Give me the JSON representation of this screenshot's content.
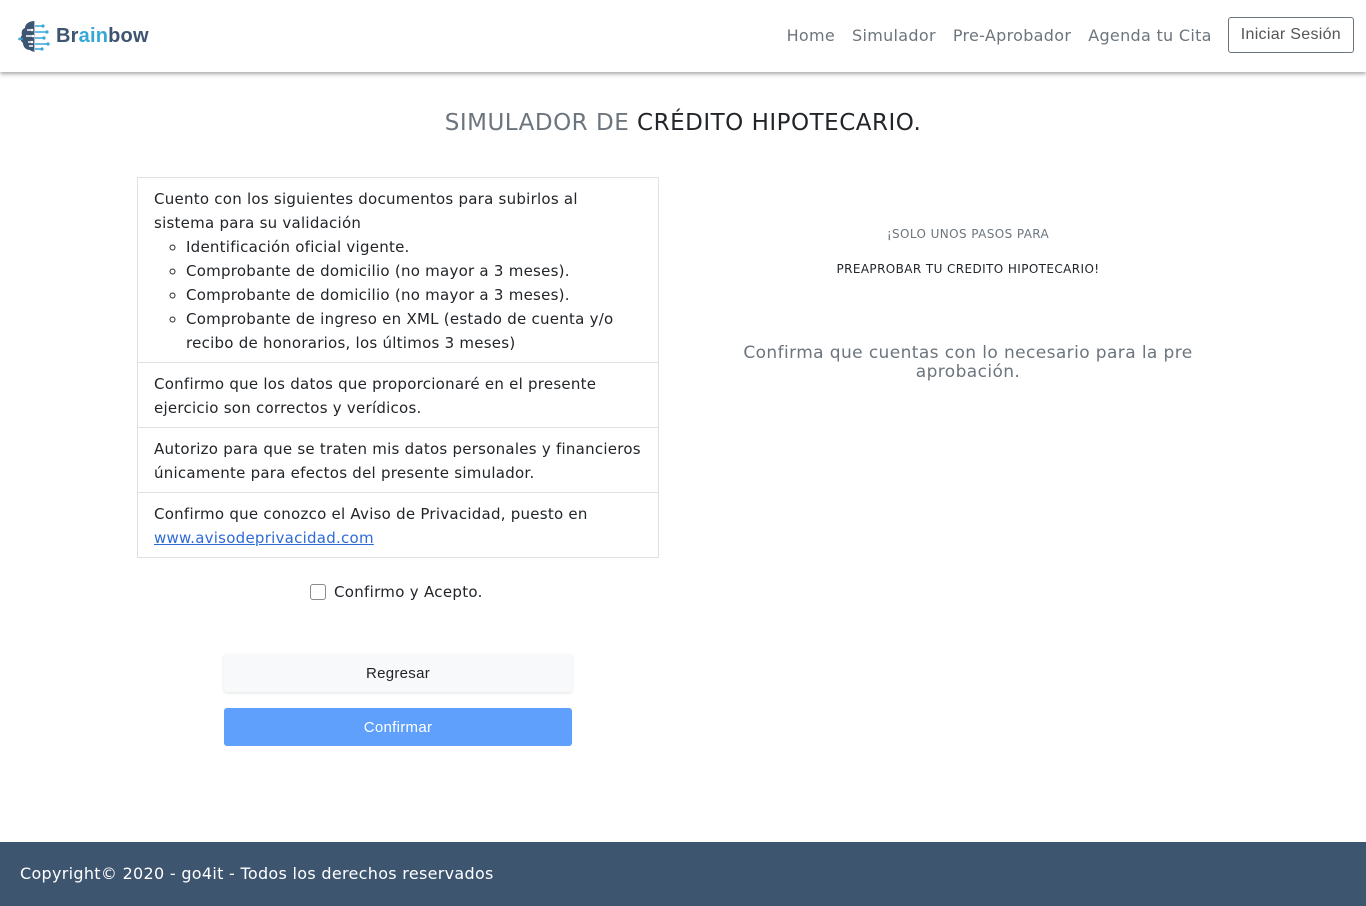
{
  "header": {
    "logo": {
      "part1": "Br",
      "part2": "ain",
      "part3": "bow",
      "icon": "brain-circuit-icon"
    },
    "nav": [
      "Home",
      "Simulador",
      "Pre-Aprobador",
      "Agenda tu Cita"
    ],
    "login_label": "Iniciar Sesión"
  },
  "title": {
    "muted": "SIMULADOR DE",
    "strong": "CRÉDITO HIPOTECARIO."
  },
  "requirements": {
    "intro": "Cuento con los siguientes documentos para subirlos al sistema para su validación",
    "docs": [
      "Identificación oficial vigente.",
      "Comprobante de domicilio (no mayor a 3 meses).",
      "Comprobante de domicilio (no mayor a 3 meses).",
      "Comprobante de ingreso en XML (estado de cuenta y/o recibo de honorarios, los últimos 3 meses)"
    ],
    "item2": "Confirmo que los datos que proporcionaré en el presente ejercicio son correctos y verídicos.",
    "item3": "Autorizo para que se traten mis datos personales y financieros únicamente para efectos del presente simulador.",
    "item4_text": "Confirmo que conozco el Aviso de Privacidad, puesto en",
    "item4_link": "www.avisodeprivacidad.com"
  },
  "confirm_label": "Confirmo y Acepto.",
  "buttons": {
    "back": "Regresar",
    "confirm": "Confirmar"
  },
  "right": {
    "line1": "¡SOLO UNOS PASOS PARA",
    "line2": "PREAPROBAR TU CREDITO HIPOTECARIO!",
    "lead": "Confirma que cuentas con lo necesario para la pre aprobación."
  },
  "footer": {
    "text": "Copyright© 2020 - go4it - Todos los derechos reservados"
  },
  "colors": {
    "footer_bg": "#3e5570",
    "confirm_btn": "#5fa0fc",
    "logo_dark": "#3d5570",
    "logo_accent": "#36a8d8"
  }
}
